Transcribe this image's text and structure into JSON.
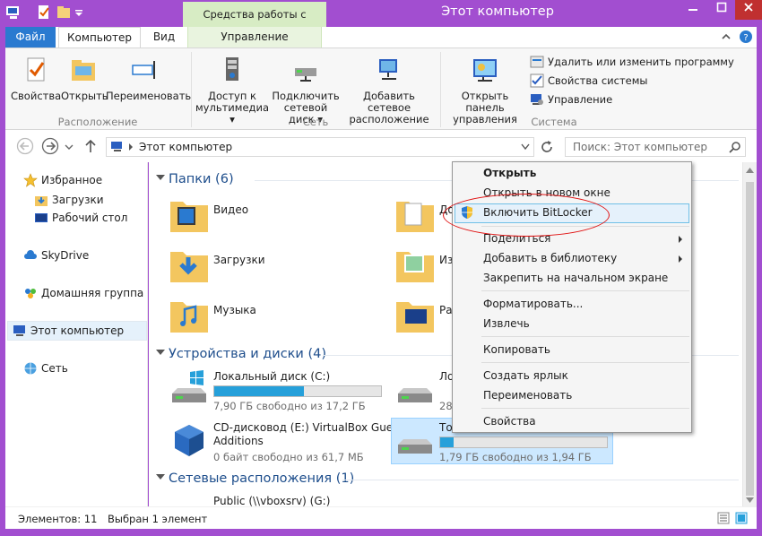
{
  "window": {
    "title": "Этот компьютер",
    "contextual_tab_group": "Средства работы с дисками"
  },
  "ribbon_tabs": {
    "file": "Файл",
    "computer": "Компьютер",
    "view": "Вид",
    "manage": "Управление"
  },
  "ribbon": {
    "location": {
      "group": "Расположение",
      "properties": "Свойства",
      "open": "Открыть",
      "rename": "Переименовать"
    },
    "network": {
      "group": "Сеть",
      "media_line1": "Доступ к",
      "media_line2": "мультимедиа",
      "map_line1": "Подключить",
      "map_line2": "сетевой диск",
      "add_line1": "Добавить сетевое",
      "add_line2": "расположение"
    },
    "system": {
      "group": "Система",
      "panel_line1": "Открыть панель",
      "panel_line2": "управления",
      "uninstall": "Удалить или изменить программу",
      "sysprops": "Свойства системы",
      "manage": "Управление"
    }
  },
  "address": {
    "path": "Этот компьютер",
    "search_placeholder": "Поиск: Этот компьютер"
  },
  "nav": {
    "favorites": "Избранное",
    "downloads": "Загрузки",
    "desktop": "Рабочий стол",
    "skydrive": "SkyDrive",
    "homegroup": "Домашняя группа",
    "computer": "Этот компьютер",
    "network": "Сеть"
  },
  "sections": {
    "folders": "Папки (6)",
    "devices": "Устройства и диски (4)",
    "network": "Сетевые расположения (1)"
  },
  "folders": [
    {
      "label": "Видео"
    },
    {
      "label": "До"
    },
    {
      "label": "Загрузки"
    },
    {
      "label": "Из"
    },
    {
      "label": "Музыка"
    },
    {
      "label": "Ра"
    }
  ],
  "drives": {
    "c": {
      "label": "Локальный диск (C:)",
      "free": "7,90 ГБ свободно из 17,2 ГБ",
      "used_fraction": 0.54
    },
    "d": {
      "label": "Ло",
      "free": "28"
    },
    "e": {
      "label_line1": "CD-дисковод (E:) VirtualBox Guest",
      "label_line2": "Additions",
      "free": "0 байт свободно из 61,7 МБ"
    },
    "f": {
      "label": "То",
      "free": "1,79 ГБ свободно из 1,94 ГБ",
      "used_fraction": 0.08
    }
  },
  "network_locations": [
    {
      "label": "Public (\\\\vboxsrv) (G:)"
    }
  ],
  "status": {
    "count": "Элементов: 11",
    "selected": "Выбран 1 элемент"
  },
  "context_menu": {
    "open": "Открыть",
    "open_new": "Открыть в новом окне",
    "bitlocker": "Включить BitLocker",
    "share": "Поделиться",
    "add_library": "Добавить в библиотеку",
    "pin": "Закрепить на начальном экране",
    "format": "Форматировать...",
    "eject": "Извлечь",
    "copy": "Копировать",
    "shortcut": "Создать ярлык",
    "rename": "Переименовать",
    "properties": "Свойства"
  },
  "colors": {
    "titlebar": "#a24ed0",
    "accent": "#2a7ad0",
    "progress": "#26a0da",
    "highlight_ring": "#e01010"
  }
}
